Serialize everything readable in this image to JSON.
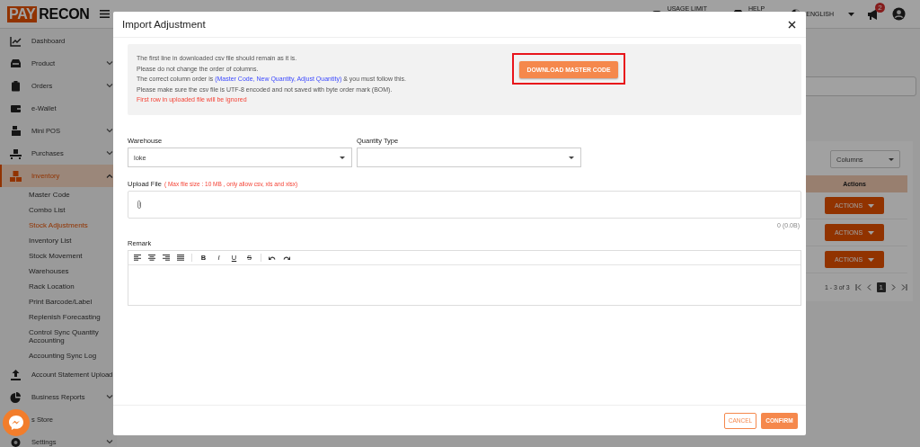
{
  "topbar": {
    "logo": {
      "part1": "PAY",
      "part2": "RECON"
    },
    "usage": "USAGE LIMIT",
    "help": "HELP",
    "language": "ENGLISH",
    "notifications": "2"
  },
  "sidebar": {
    "items": [
      {
        "label": "Dashboard",
        "expandable": false,
        "selected": false
      },
      {
        "label": "Product",
        "expandable": true,
        "expanded": false,
        "selected": false
      },
      {
        "label": "Orders",
        "expandable": true,
        "expanded": false,
        "selected": false
      },
      {
        "label": "e-Wallet",
        "expandable": false,
        "selected": false
      },
      {
        "label": "Mini POS",
        "expandable": true,
        "expanded": false,
        "selected": false
      },
      {
        "label": "Purchases",
        "expandable": true,
        "expanded": false,
        "selected": false
      },
      {
        "label": "Inventory",
        "expandable": true,
        "expanded": true,
        "selected": true,
        "children": [
          {
            "label": "Master Code",
            "selected": false
          },
          {
            "label": "Combo List",
            "selected": false
          },
          {
            "label": "Stock Adjustments",
            "selected": true
          },
          {
            "label": "Inventory List",
            "selected": false
          },
          {
            "label": "Stock Movement",
            "selected": false
          },
          {
            "label": "Warehouses",
            "selected": false
          },
          {
            "label": "Rack Location",
            "selected": false
          },
          {
            "label": "Print Barcode/Label",
            "selected": false
          },
          {
            "label": "Replenish Forecasting",
            "selected": false
          },
          {
            "label": "Control Sync Quantity Accounting",
            "selected": false
          },
          {
            "label": "Accounting Sync Log",
            "selected": false
          }
        ]
      },
      {
        "label": "Account Statement Upload",
        "expandable": false,
        "selected": false
      },
      {
        "label": "Business Reports",
        "expandable": true,
        "expanded": false,
        "selected": false
      },
      {
        "label": "s Store",
        "expandable": false,
        "selected": false
      },
      {
        "label": "Settings",
        "expandable": true,
        "expanded": false,
        "selected": false
      }
    ]
  },
  "page": {
    "columns_select": "Columns",
    "table": {
      "header": "Actions",
      "rows": [
        {
          "action": "ACTIONS"
        },
        {
          "action": "ACTIONS"
        },
        {
          "action": "ACTIONS"
        }
      ]
    },
    "pagination": {
      "range": "1 - 3 of 3",
      "page": "1"
    }
  },
  "modal": {
    "title": "Import Adjustment",
    "notes": [
      {
        "kind": "info",
        "parts": [
          {
            "text": "The first line in downloaded csv file should remain as it is.",
            "highlight": false
          }
        ]
      },
      {
        "kind": "info",
        "parts": [
          {
            "text": "Please do not change the order of columns.",
            "highlight": false
          }
        ]
      },
      {
        "kind": "info",
        "parts": [
          {
            "text": "The correct column order is ",
            "highlight": false
          },
          {
            "text": "(Master Code, New Quantity, Adjust Quantity)",
            "highlight": true
          },
          {
            "text": " & you must follow this.",
            "highlight": false
          }
        ]
      },
      {
        "kind": "info",
        "parts": [
          {
            "text": "Please make sure the csv file is UTF-8 encoded and not saved with byte order mark (BOM).",
            "highlight": false
          }
        ]
      },
      {
        "kind": "warning",
        "parts": [
          {
            "text": "First row in uploaded file will be ignored",
            "highlight": false
          }
        ]
      }
    ],
    "download_button": {
      "label": "DOWNLOAD MASTER CODE",
      "highlighted": true
    },
    "warehouse": {
      "label": "Warehouse",
      "value": "loke"
    },
    "quantity_type": {
      "label": "Quantity Type"
    },
    "upload": {
      "label": "Upload File",
      "hint": "( Max file size : 10 MB , only allow csv, xls and xlsx)",
      "size": "0 (0.0B)"
    },
    "remark": {
      "label": "Remark",
      "format_buttons": [
        {
          "label": "B",
          "kind": "bold"
        },
        {
          "label": "I",
          "kind": "italic"
        },
        {
          "label": "U",
          "kind": "underline"
        },
        {
          "label": "S",
          "kind": "strike"
        }
      ]
    },
    "buttons": {
      "cancel": "CANCEL",
      "confirm": "CONFIRM"
    }
  }
}
